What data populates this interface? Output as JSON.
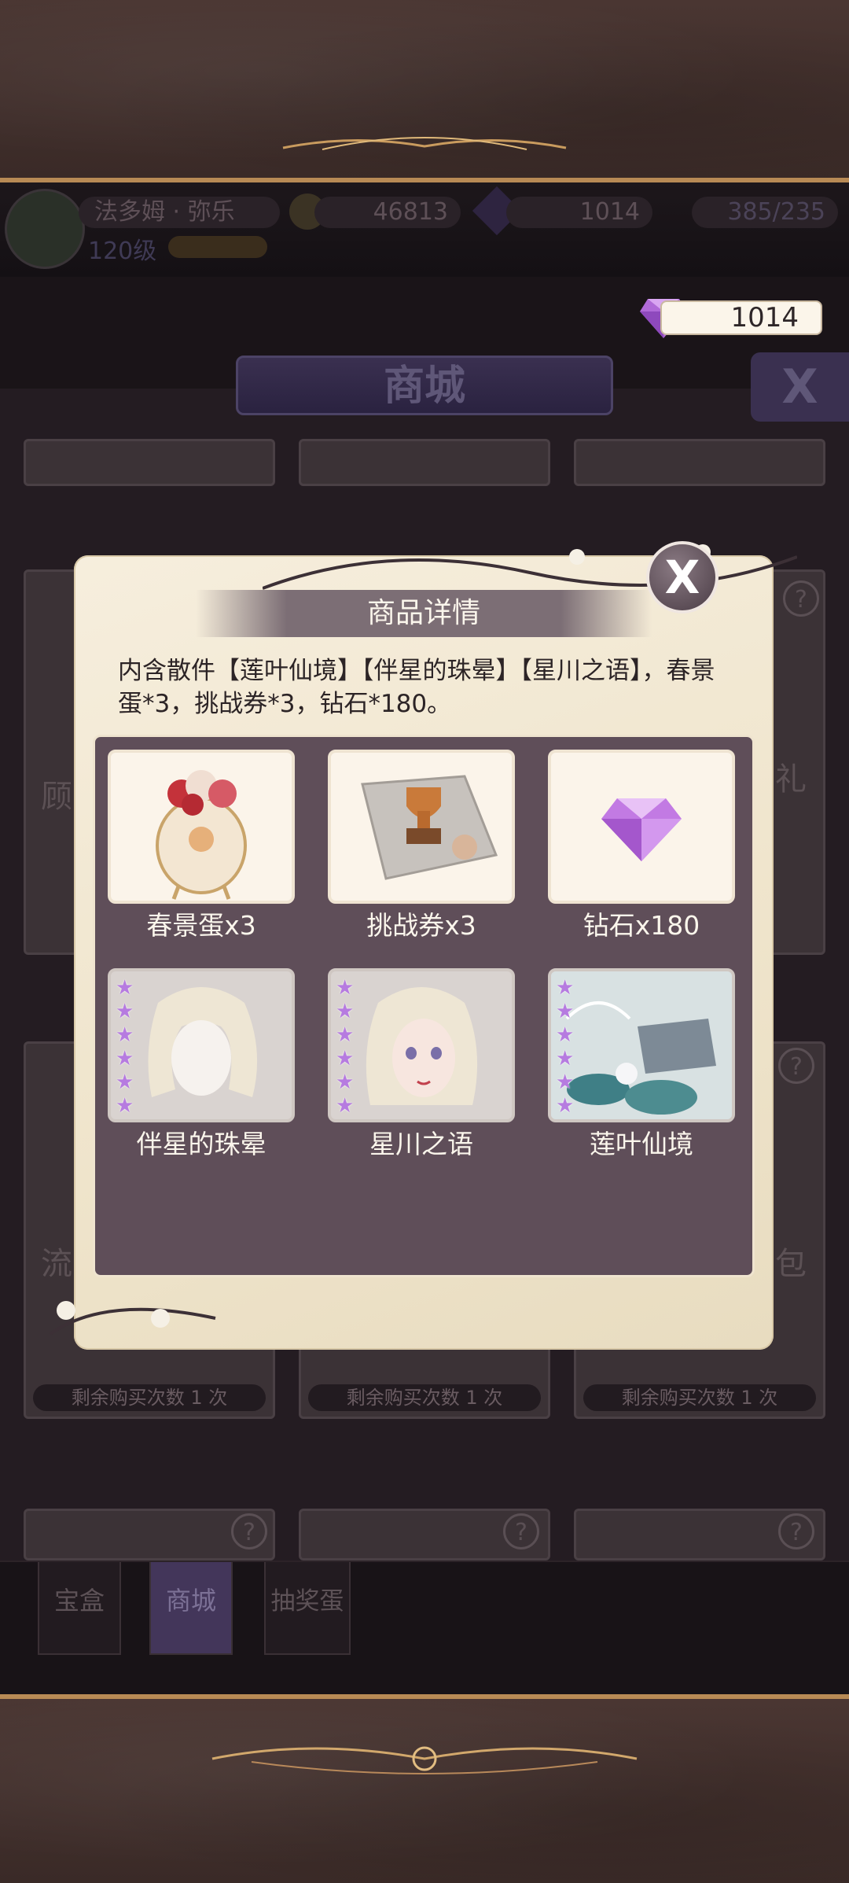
{
  "hud": {
    "player_name": "法多姆 · 弥乐",
    "player_level": "120级",
    "coins": "46813",
    "gems": "1014",
    "stamina": "385/235"
  },
  "diamond_counter": "1014",
  "shop": {
    "title": "商城",
    "close_label": "X",
    "card_partial_left": "顾",
    "card_partial_right": "礼",
    "card_partial_left2": "流",
    "card_partial_right2": "包",
    "remaining_label": "剩余购买次数 1 次",
    "help_label": "?"
  },
  "tabs": [
    {
      "label": "宝盒"
    },
    {
      "label": "商城"
    },
    {
      "label": "抽奖蛋"
    }
  ],
  "popup": {
    "title": "商品详情",
    "description": "内含散件【莲叶仙境】【伴星的珠晕】【星川之语】，春景蛋*3，挑战券*3，钻石*180。",
    "close_label": "X",
    "items": [
      {
        "label": "春景蛋x3",
        "icon": "flower-egg-icon"
      },
      {
        "label": "挑战券x3",
        "icon": "trophy-ticket-icon"
      },
      {
        "label": "钻石x180",
        "icon": "diamond-icon"
      },
      {
        "label": "伴星的珠晕",
        "icon": "hair-piece-icon"
      },
      {
        "label": "星川之语",
        "icon": "portrait-icon"
      },
      {
        "label": "莲叶仙境",
        "icon": "lotus-scene-icon"
      }
    ]
  },
  "colors": {
    "accent_purple": "#b67be0",
    "parchment": "#f6eedd",
    "inner_panel": "#5f4e59"
  }
}
